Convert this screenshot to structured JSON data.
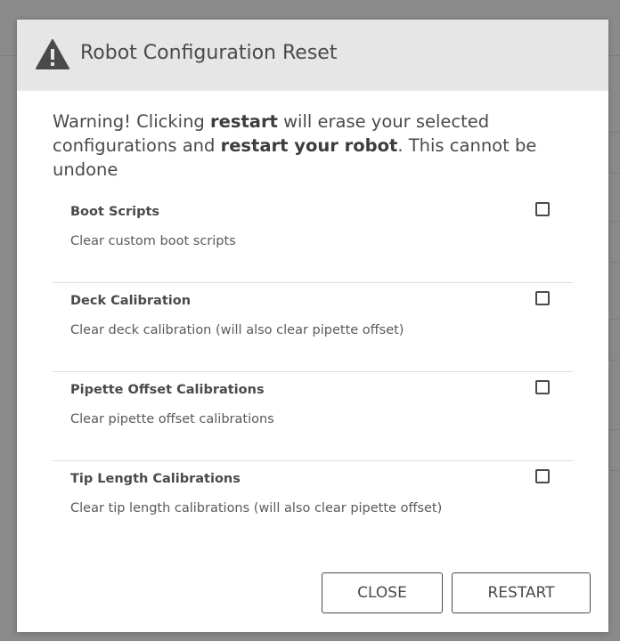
{
  "dialog": {
    "title": "Robot Configuration Reset",
    "warning_prefix": "Warning! Clicking ",
    "warning_bold_1": "restart",
    "warning_middle": " will erase your selected configurations and ",
    "warning_bold_2": "restart your robot",
    "warning_suffix": ". This cannot be undone",
    "options": [
      {
        "name": "Boot Scripts",
        "description": "Clear custom boot scripts",
        "checked": false
      },
      {
        "name": "Deck Calibration",
        "description": "Clear deck calibration (will also clear pipette offset)",
        "checked": false
      },
      {
        "name": "Pipette Offset Calibrations",
        "description": "Clear pipette offset calibrations",
        "checked": false
      },
      {
        "name": "Tip Length Calibrations",
        "description": "Clear tip length calibrations (will also clear pipette offset)",
        "checked": false
      }
    ],
    "close_label": "CLOSE",
    "restart_label": "RESTART"
  },
  "colors": {
    "overlay": "#7a7a7a",
    "header_bg": "#e6e6e6",
    "text": "#4a4a4a",
    "divider": "#dcdcdc"
  }
}
